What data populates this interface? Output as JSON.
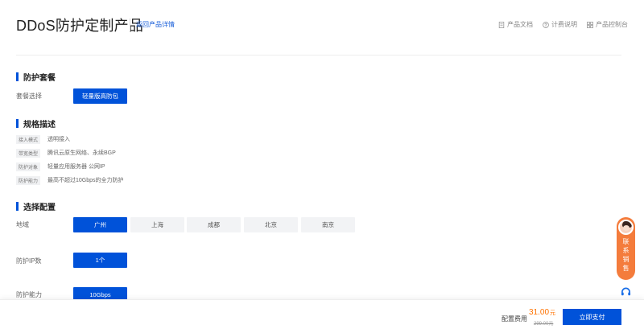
{
  "header": {
    "title": "DDoS防护定制产品",
    "back_link": "返回产品详情",
    "links": [
      {
        "label": "产品文档",
        "icon": "document-icon"
      },
      {
        "label": "计费说明",
        "icon": "question-circle-icon"
      },
      {
        "label": "产品控制台",
        "icon": "grid-icon"
      }
    ]
  },
  "package_section": {
    "title": "防护套餐",
    "field_label": "套餐选择",
    "selected_option": "轻量版高防包"
  },
  "spec_section": {
    "title": "规格描述",
    "rows": [
      {
        "tag": "接入模式",
        "value": "透明接入"
      },
      {
        "tag": "带宽类型",
        "value": "腾讯云原生网络、永续BGP"
      },
      {
        "tag": "防护对象",
        "value": "轻量应用服务器 公网IP"
      },
      {
        "tag": "防护能力",
        "value": "最高不超过10Gbps的全力防护"
      }
    ]
  },
  "config_section": {
    "title": "选择配置",
    "region_label": "地域",
    "regions": [
      "广州",
      "上海",
      "成都",
      "北京",
      "南京"
    ],
    "selected_region": "广州",
    "ip_label": "防护IP数",
    "ip_value": "1个",
    "capacity_label": "防护能力",
    "capacity_value": "10Gbps"
  },
  "contact": {
    "label_chars": [
      "联",
      "系",
      "销",
      "售"
    ]
  },
  "footer": {
    "cost_label": "配置费用",
    "price": "31.00",
    "price_unit": "元",
    "original_price": "299.00元",
    "buy_button": "立即支付"
  },
  "colors": {
    "primary": "#0052d9",
    "price": "#ff7200",
    "contact_bg": "#f47c3c"
  }
}
